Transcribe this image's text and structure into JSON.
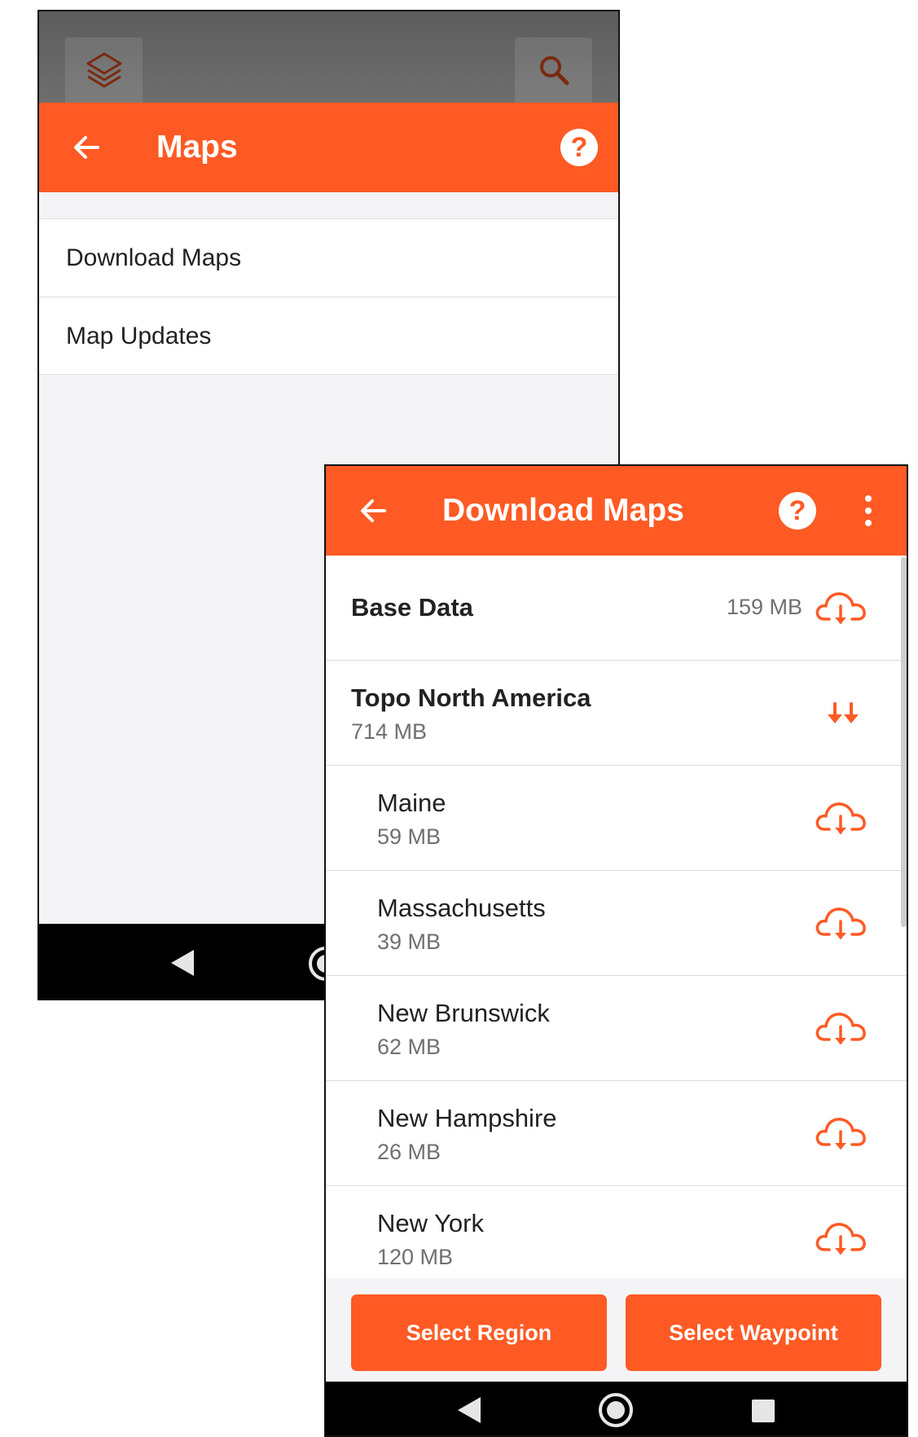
{
  "maps_screen": {
    "title": "Maps",
    "help_symbol": "?",
    "topbar_icons": [
      "layers-icon",
      "search-icon"
    ],
    "items": [
      {
        "label": "Download Maps"
      },
      {
        "label": "Map Updates"
      }
    ]
  },
  "download_screen": {
    "title": "Download Maps",
    "help_symbol": "?",
    "base_data": {
      "label": "Base Data",
      "size": "159 MB"
    },
    "topo": {
      "label": "Topo North America",
      "size": "714 MB"
    },
    "regions": [
      {
        "name": "Maine",
        "size": "59 MB"
      },
      {
        "name": "Massachusetts",
        "size": "39 MB"
      },
      {
        "name": "New Brunswick",
        "size": "62 MB"
      },
      {
        "name": "New Hampshire",
        "size": "26 MB"
      },
      {
        "name": "New York",
        "size": "120 MB"
      }
    ],
    "buttons": {
      "select_region": "Select Region",
      "select_waypoint": "Select Waypoint"
    }
  },
  "colors": {
    "accent": "#ff5a24",
    "topbar": "#666666",
    "navbar": "#000000"
  }
}
